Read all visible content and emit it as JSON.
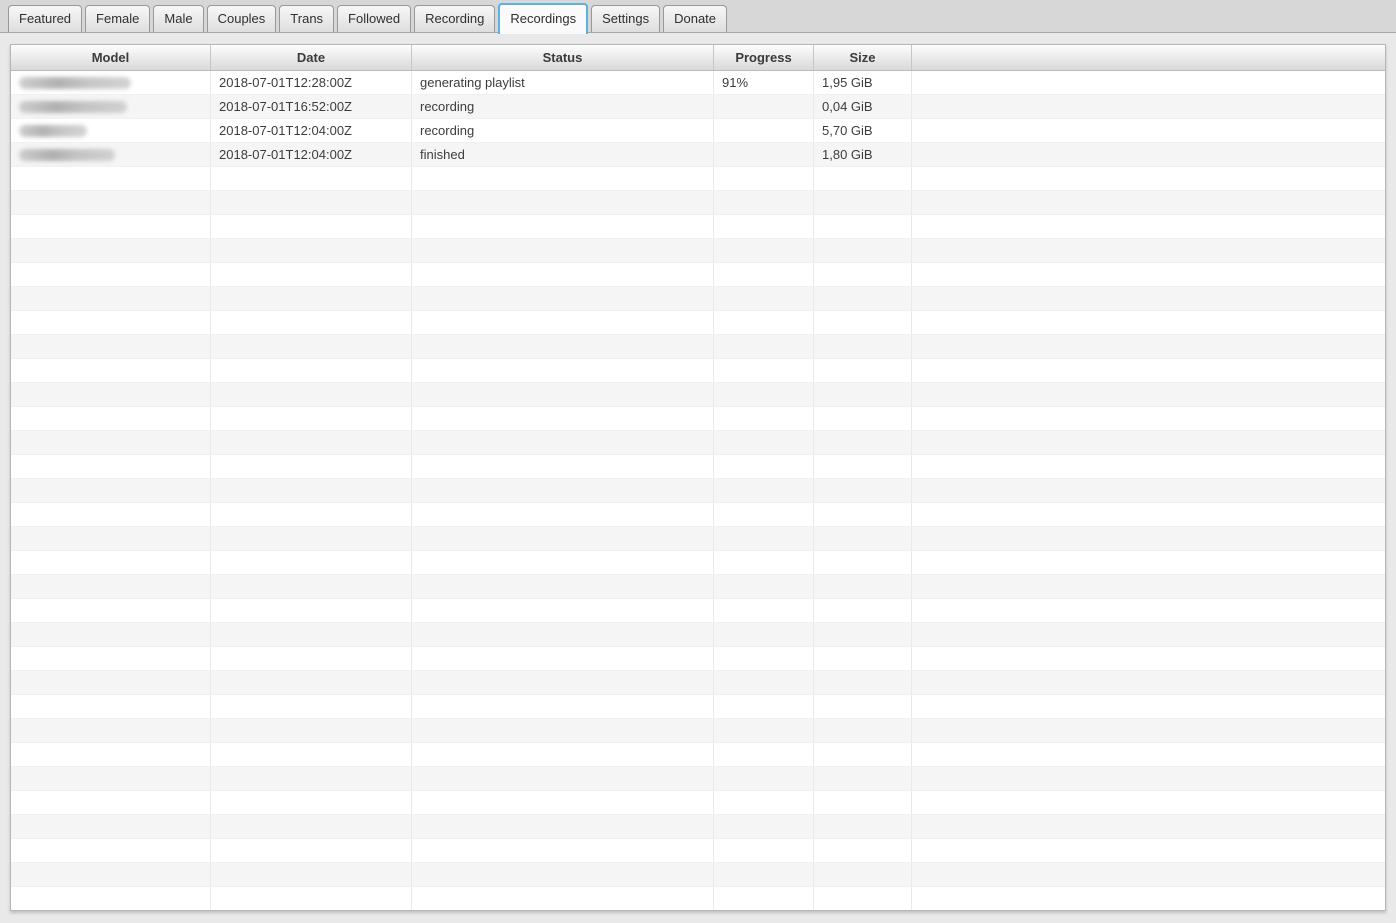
{
  "tabbar": {
    "tabs": [
      {
        "label": "Featured",
        "active": false
      },
      {
        "label": "Female",
        "active": false
      },
      {
        "label": "Male",
        "active": false
      },
      {
        "label": "Couples",
        "active": false
      },
      {
        "label": "Trans",
        "active": false
      },
      {
        "label": "Followed",
        "active": false
      },
      {
        "label": "Recording",
        "active": false
      },
      {
        "label": "Recordings",
        "active": true
      },
      {
        "label": "Settings",
        "active": false
      },
      {
        "label": "Donate",
        "active": false
      }
    ]
  },
  "table": {
    "columns": [
      {
        "label": "Model"
      },
      {
        "label": "Date"
      },
      {
        "label": "Status"
      },
      {
        "label": "Progress"
      },
      {
        "label": "Size"
      },
      {
        "label": ""
      }
    ],
    "rows": [
      {
        "model_redacted": true,
        "model_blur_width": 112,
        "date": "2018-07-01T12:28:00Z",
        "status": "generating playlist",
        "progress": "91%",
        "size": "1,95 GiB"
      },
      {
        "model_redacted": true,
        "model_blur_width": 108,
        "date": "2018-07-01T16:52:00Z",
        "status": "recording",
        "progress": "",
        "size": "0,04 GiB"
      },
      {
        "model_redacted": true,
        "model_blur_width": 68,
        "date": "2018-07-01T12:04:00Z",
        "status": "recording",
        "progress": "",
        "size": "5,70 GiB"
      },
      {
        "model_redacted": true,
        "model_blur_width": 96,
        "date": "2018-07-01T12:04:00Z",
        "status": "finished",
        "progress": "",
        "size": "1,80 GiB"
      }
    ],
    "empty_row_count": 31
  },
  "colors": {
    "active_tab_border": "#5fb0dd",
    "page_background": "#e9e9e9",
    "tabbar_background": "#d7d7d7",
    "row_stripe": "#f5f5f5",
    "text": "#3c3c3c"
  }
}
